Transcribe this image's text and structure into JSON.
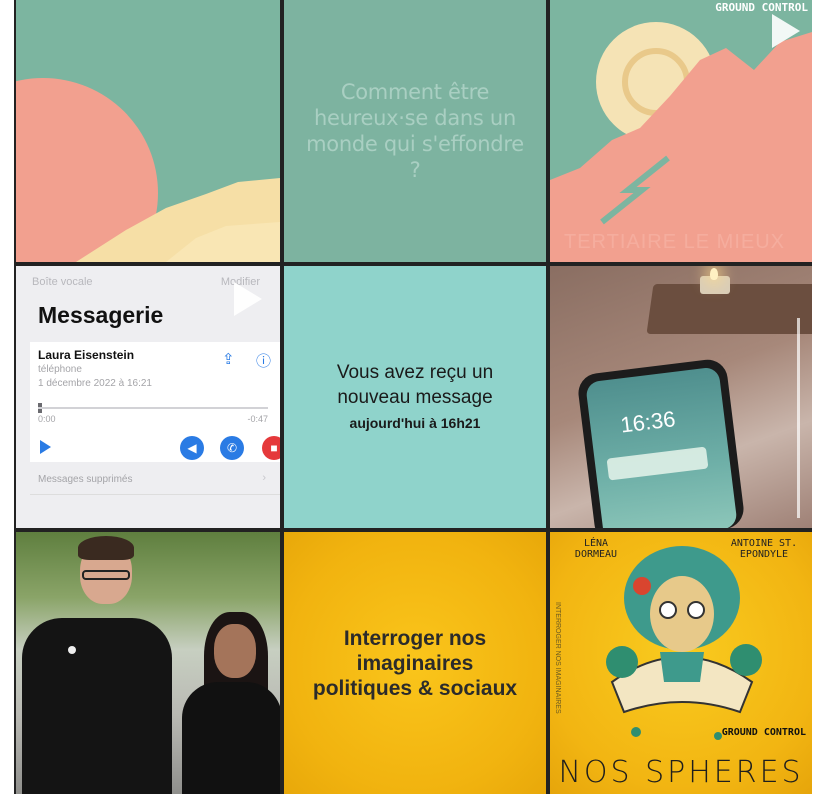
{
  "feed": {
    "tile2_quote": "Comment être heureux·se dans un monde qui s'effondre ?",
    "tile3_logo": "GROUND CONTROL",
    "tile3_caption": "TERTIAIRE LE MIEUX",
    "voicemail": {
      "back": "Boîte vocale",
      "edit": "Modifier",
      "title": "Messagerie",
      "name": "Laura Eisenstein",
      "source": "téléphone",
      "date": "1 décembre 2022 à 16:21",
      "elapsed": "0:00",
      "remaining": "-0:47",
      "deleted": "Messages supprimés"
    },
    "tile5": {
      "line1": "Vous avez reçu un",
      "line2": "nouveau message",
      "line3": "aujourd'hui à 16h21"
    },
    "tile6_clock": "16:36",
    "tile8_text": "Interroger nos imaginaires politiques & sociaux",
    "tile9": {
      "author_left": "LÉNA DORMEAU",
      "author_right": "ANTOINE ST. EPONDYLE",
      "brand": "GROUND CONTROL",
      "title": "NOS SPHERES",
      "vertical": "INTERROGER NOS IMAGINAIRES"
    }
  },
  "icons": [
    "play-icon",
    "share-icon",
    "info-icon",
    "speaker-icon",
    "phone-icon",
    "trash-icon"
  ],
  "colors": {
    "accent_blue": "#2a7be4",
    "delete_red": "#e5393b",
    "mint": "#7cb5a0",
    "yellow": "#f5bd14"
  }
}
